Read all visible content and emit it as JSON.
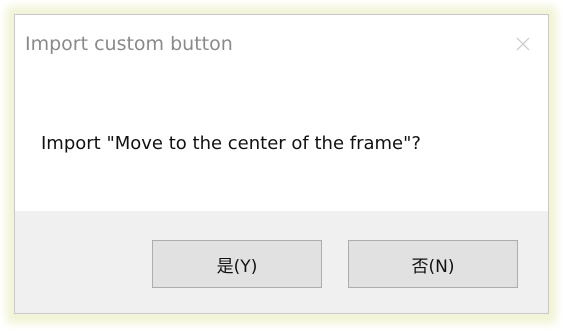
{
  "dialog": {
    "title": "Import custom button",
    "message": "Import \"Move to the center of the frame\"?",
    "close_icon": "close-icon"
  },
  "buttons": {
    "yes_label": "是(Y)",
    "no_label": "否(N)"
  },
  "colors": {
    "title_text": "#8a8a8a",
    "footer_bg": "#f0f0f0",
    "button_bg": "#e1e1e1",
    "button_border": "#adadad"
  }
}
